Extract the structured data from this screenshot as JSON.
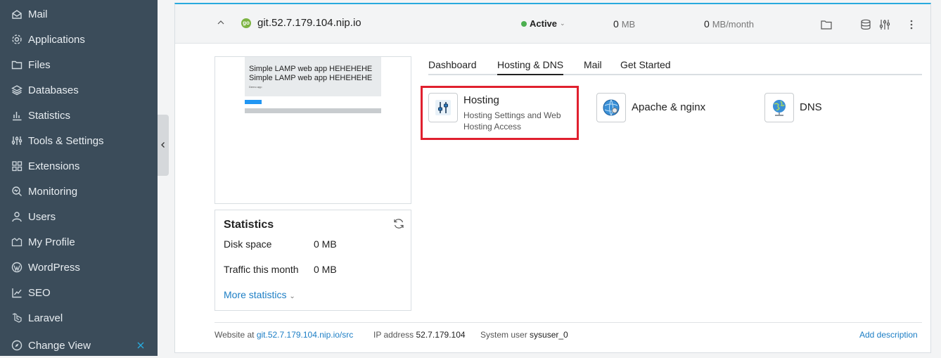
{
  "sidebar": {
    "items": [
      {
        "label": "Mail",
        "icon": "mail-icon"
      },
      {
        "label": "Applications",
        "icon": "gear-icon"
      },
      {
        "label": "Files",
        "icon": "folder-icon"
      },
      {
        "label": "Databases",
        "icon": "layers-icon"
      },
      {
        "label": "Statistics",
        "icon": "bar-chart-icon"
      },
      {
        "label": "Tools & Settings",
        "icon": "sliders-icon"
      },
      {
        "label": "Extensions",
        "icon": "grid-icon"
      },
      {
        "label": "Monitoring",
        "icon": "monitor-search-icon"
      },
      {
        "label": "Users",
        "icon": "user-icon"
      },
      {
        "label": "My Profile",
        "icon": "profile-icon"
      },
      {
        "label": "WordPress",
        "icon": "wordpress-icon"
      },
      {
        "label": "SEO",
        "icon": "seo-icon"
      },
      {
        "label": "Laravel",
        "icon": "laravel-icon"
      },
      {
        "label": "Change View",
        "icon": "compass-icon"
      }
    ]
  },
  "domain": {
    "name": "git.52.7.179.104.nip.io",
    "status": "Active",
    "disk_value": "0",
    "disk_unit": "MB",
    "traffic_value": "0",
    "traffic_unit": "MB/month"
  },
  "preview": {
    "line1": "Simple LAMP web app HEHEHEHE",
    "line2": "Simple LAMP web app HEHEHEHE",
    "small": "Demo app"
  },
  "stats": {
    "title": "Statistics",
    "disk_label": "Disk space",
    "disk_value": "0 MB",
    "traffic_label": "Traffic this month",
    "traffic_value": "0 MB",
    "more": "More statistics"
  },
  "tabs": [
    "Dashboard",
    "Hosting & DNS",
    "Mail",
    "Get Started"
  ],
  "active_tab": "Hosting & DNS",
  "cards": {
    "hosting_title": "Hosting",
    "hosting_sub": "Hosting Settings and Web Hosting Access",
    "apache_title": "Apache & nginx",
    "dns_title": "DNS"
  },
  "footer": {
    "website_label": "Website at",
    "website_link": "git.52.7.179.104.nip.io/src",
    "ip_label": "IP address",
    "ip_value": "52.7.179.104",
    "sysuser_label": "System user",
    "sysuser_value": "sysuser_0",
    "add_description": "Add description"
  },
  "colors": {
    "sidebar_bg": "#3b4c5a",
    "accent": "#28aade",
    "link": "#1c7ec5",
    "highlight": "#e0202e",
    "active_dot": "#4caf50"
  }
}
